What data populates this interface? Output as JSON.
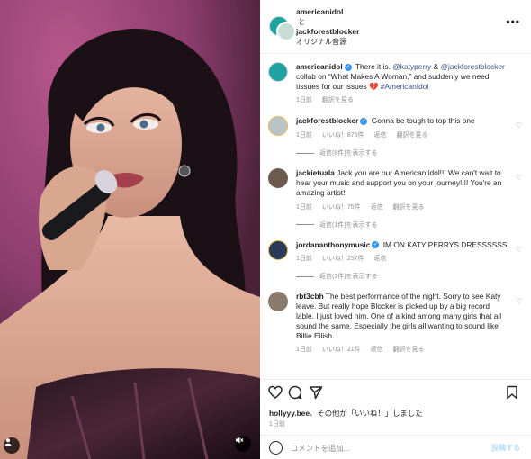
{
  "header": {
    "username": "americanidol",
    "separator": "と",
    "collaborator": "jackforestblocker",
    "audio": "オリジナル音源",
    "more_icon": "more-horizontal-icon"
  },
  "caption": {
    "username": "americanidol",
    "text_a": " There it is. ",
    "mention1": "@katyperry",
    "text_b": " & ",
    "mention2": "@jackforestblocker",
    "text_c": " collab on “What Makes A Woman,” and suddenly we need tissues for our issues 💔 ",
    "hashtag": "#AmericanIdol",
    "time": "1日前",
    "translate": "翻訳を見る"
  },
  "comments": [
    {
      "username": "jackforestblocker",
      "verified": true,
      "text": "Gonna be tough to top this one",
      "time": "1日前",
      "likes": "いいね！875件",
      "reply": "返信",
      "translate": "翻訳を見る",
      "replies": "返信(8件)を表示する",
      "avatar_color": "#b9c4c9"
    },
    {
      "username": "jackietuala",
      "verified": false,
      "text": "Jack you are our American idol!!! We can't wait to hear your music and support you on your journey!!!! You're an amazing artist!",
      "time": "1日前",
      "likes": "いいね！75件",
      "reply": "返信",
      "translate": "翻訳を見る",
      "replies": "返信(1件)を表示する",
      "avatar_color": "#6d5a4f"
    },
    {
      "username": "jordananthonymusic",
      "verified": true,
      "text": "IM ON KATY PERRYS DRESSSSSS",
      "time": "1日前",
      "likes": "いいね！257件",
      "reply": "返信",
      "translate": "",
      "replies": "返信(3件)を表示する",
      "avatar_color": "#2c3a5a"
    },
    {
      "username": "rbt3cbh",
      "verified": false,
      "text": "The best performance of the night. Sorry to see Katy leave. But really hope Blocker is picked up by a big record lable. I just loved him. One of a kind among many girls that all sound the same. Especially the girls all wanting to sound like Billie Eilish.",
      "time": "1日前",
      "likes": "いいね！21件",
      "reply": "返信",
      "translate": "翻訳を見る",
      "replies": "",
      "avatar_color": "#8a7a6c"
    }
  ],
  "actions": {
    "liked_by_user": "hollyyy.bee",
    "liked_by_rest": "、その他が「いいね！」しました",
    "date": "1日前",
    "comment_placeholder": "コメントを追加...",
    "post_label": "投稿する"
  },
  "colors": {
    "link": "#385185",
    "muted": "#8e8e8e",
    "verified": "#3897f0",
    "post_disabled": "#b2dffc"
  }
}
